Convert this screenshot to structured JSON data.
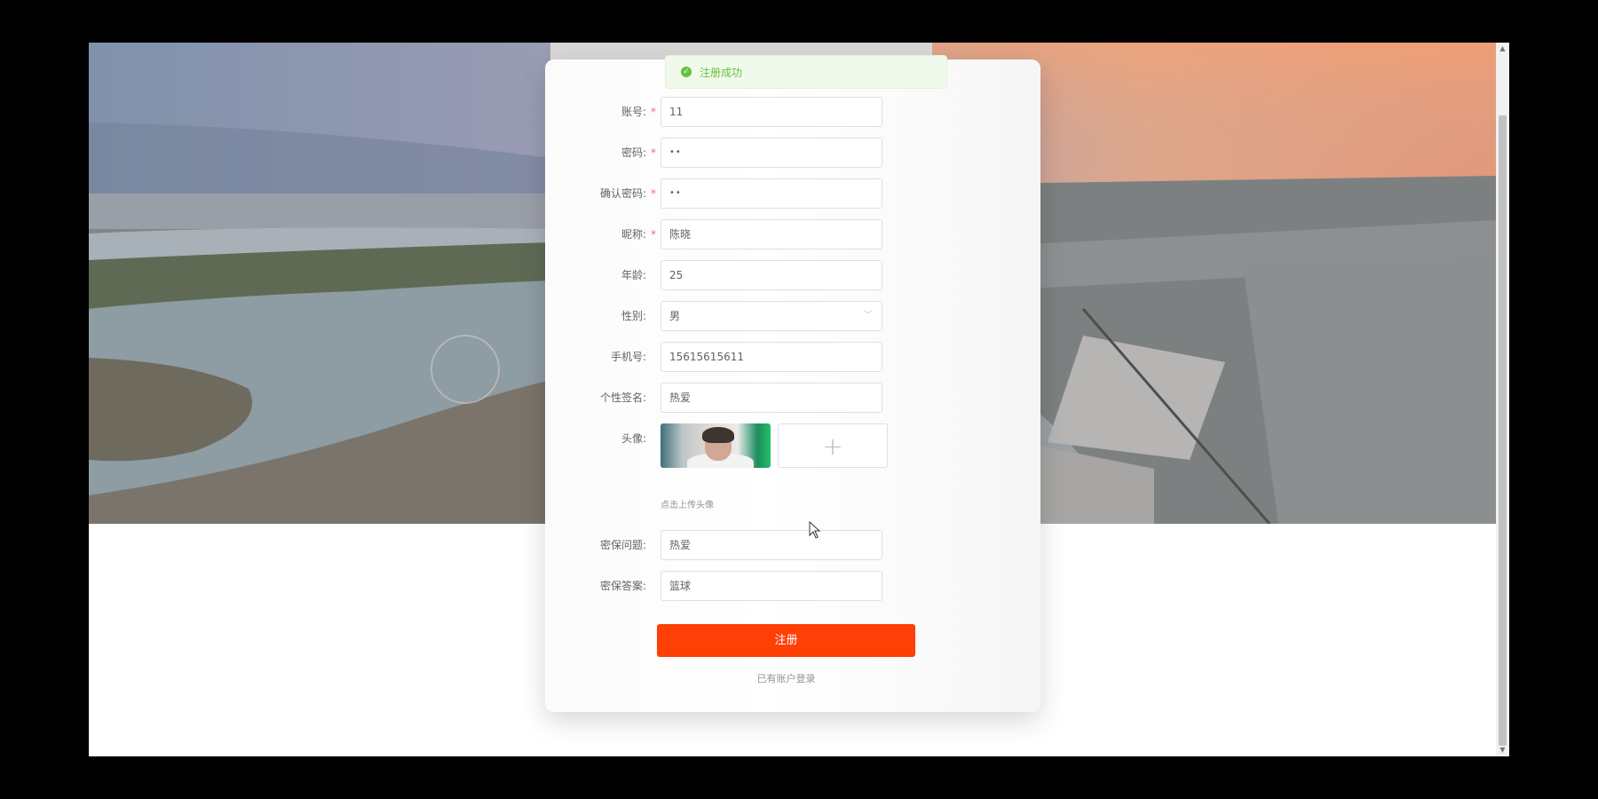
{
  "toast": {
    "icon": "check-circle-icon",
    "message": "注册成功",
    "color": "#67c23a"
  },
  "form": {
    "account": {
      "label": "账号:",
      "required": "*",
      "value": "11"
    },
    "password": {
      "label": "密码:",
      "required": "*",
      "value": "••"
    },
    "confirm_password": {
      "label": "确认密码:",
      "required": "*",
      "value": "••"
    },
    "nickname": {
      "label": "昵称:",
      "required": "*",
      "value": "陈晓"
    },
    "age": {
      "label": "年龄:",
      "value": "25"
    },
    "gender": {
      "label": "性别:",
      "value": "男",
      "icon": "chevron-down-icon"
    },
    "phone": {
      "label": "手机号:",
      "value": "15615615611"
    },
    "signature": {
      "label": "个性签名:",
      "value": "热爱"
    },
    "avatar": {
      "label": "头像:",
      "upload_icon": "plus-icon",
      "hint": "点击上传头像"
    },
    "security_question": {
      "label": "密保问题:",
      "value": "热爱"
    },
    "security_answer": {
      "label": "密保答案:",
      "value": "篮球"
    }
  },
  "actions": {
    "submit_label": "注册",
    "login_link": "已有账户登录"
  },
  "colors": {
    "accent": "#fe3f06",
    "required": "#f56c6c",
    "success": "#67c23a"
  }
}
